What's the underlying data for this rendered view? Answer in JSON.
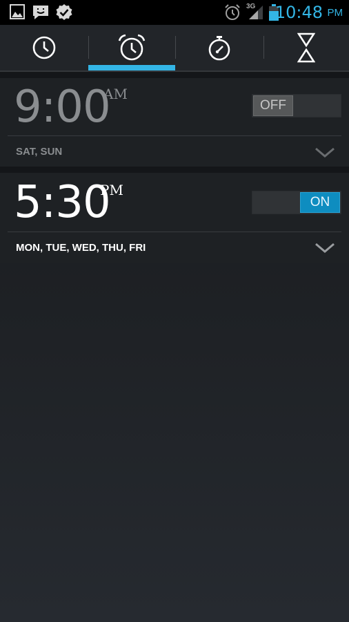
{
  "status_bar": {
    "time": "10:48",
    "ampm": "PM",
    "network": "3G",
    "accent_color": "#33b5e5",
    "notification_icons": [
      "gallery-icon",
      "chat-icon",
      "check-badge-icon"
    ],
    "system_icons": [
      "alarm-clock-icon",
      "signal-icon",
      "battery-icon"
    ]
  },
  "tabs": [
    {
      "icon": "clock-icon",
      "selected": false
    },
    {
      "icon": "alarm-icon",
      "selected": true
    },
    {
      "icon": "stopwatch-icon",
      "selected": false
    },
    {
      "icon": "timer-icon",
      "selected": false
    }
  ],
  "alarms": [
    {
      "time": "9:00",
      "ampm": "AM",
      "days": "SAT, SUN",
      "enabled": false,
      "switch_label": "OFF"
    },
    {
      "time": "5:30",
      "ampm": "PM",
      "days": "MON, TUE, WED, THU, FRI",
      "enabled": true,
      "switch_label": "ON"
    }
  ]
}
